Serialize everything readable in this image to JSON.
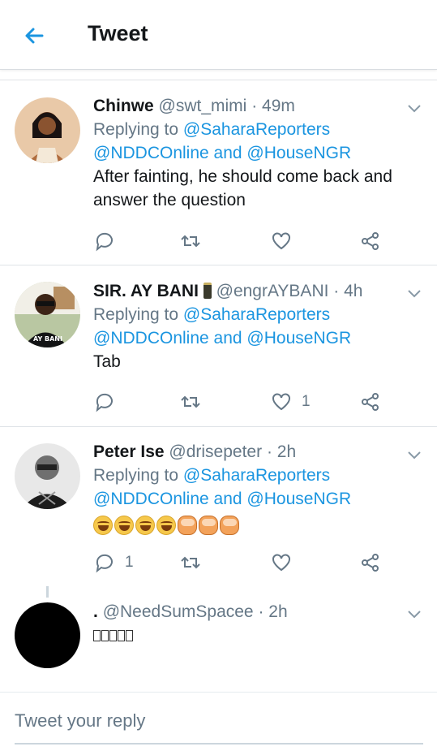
{
  "header": {
    "title": "Tweet",
    "back_icon": "arrow-left-icon"
  },
  "colors": {
    "accent": "#1b95e0",
    "muted": "#657786",
    "text": "#14171a"
  },
  "tweets": [
    {
      "name": "Chinwe",
      "handle": "@swt_mimi",
      "time": "· 49m",
      "replying_prefix": "Replying to",
      "replying_first": "@SaharaReporters",
      "replying_second": "@NDDCOnline",
      "and": "and",
      "replying_third": "@HouseNGR",
      "text_line1": "After fainting, he should come back and",
      "text_line2": "answer the question",
      "like_count": ""
    },
    {
      "name": "SIR. AY BANI",
      "handle": "@engrAYBANI",
      "time": "· 4h",
      "replying_prefix": "Replying to",
      "replying_first": "@SaharaReporters",
      "replying_second": "@NDDCOnline",
      "and": "and",
      "replying_third": "@HouseNGR",
      "text_line1": "Tab",
      "avatar_label": "AY BANI",
      "like_count": "1"
    },
    {
      "name": "Peter Ise",
      "handle": "@drisepeter",
      "time": "· 2h",
      "replying_prefix": "Replying to",
      "replying_first": "@SaharaReporters",
      "replying_second": "@NDDCOnline",
      "and": "and",
      "replying_third": "@HouseNGR",
      "reply_count": "1"
    },
    {
      "name": ".",
      "handle": "@NeedSumSpacee",
      "time": "· 2h"
    }
  ],
  "composer": {
    "placeholder": "Tweet your reply"
  }
}
